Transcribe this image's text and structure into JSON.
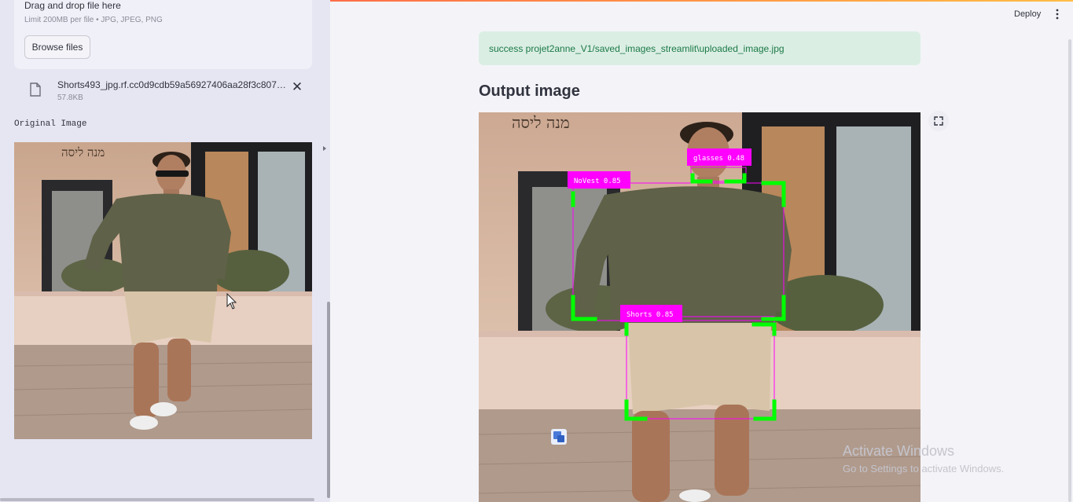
{
  "sidebar": {
    "uploader": {
      "drop_text": "Drag and drop file here",
      "limit_text": "Limit 200MB per file • JPG, JPEG, PNG",
      "browse_label": "Browse files"
    },
    "file": {
      "name": "Shorts493_jpg.rf.cc0d9cdb59a56927406aa28f3c8074...",
      "size": "57.8KB",
      "remove_symbol": "✕"
    },
    "original_label": "Original Image"
  },
  "header": {
    "deploy_label": "Deploy"
  },
  "main": {
    "success_message": "success projet2anne_V1/saved_images_streamlit\\uploaded_image.jpg",
    "output_title": "Output image",
    "detections": [
      {
        "label": "NoVest 0.85",
        "color": "#ff00ff"
      },
      {
        "label": "glasses 0.48",
        "color": "#ff00ff"
      },
      {
        "label": "Shorts 0.85",
        "color": "#ff00ff"
      }
    ],
    "corner_color": "#00ff00",
    "storefront_sign": "מנה ליסה"
  },
  "overlay": {
    "activate_title": "Activate Windows",
    "activate_sub": "Go to Settings to activate Windows."
  }
}
